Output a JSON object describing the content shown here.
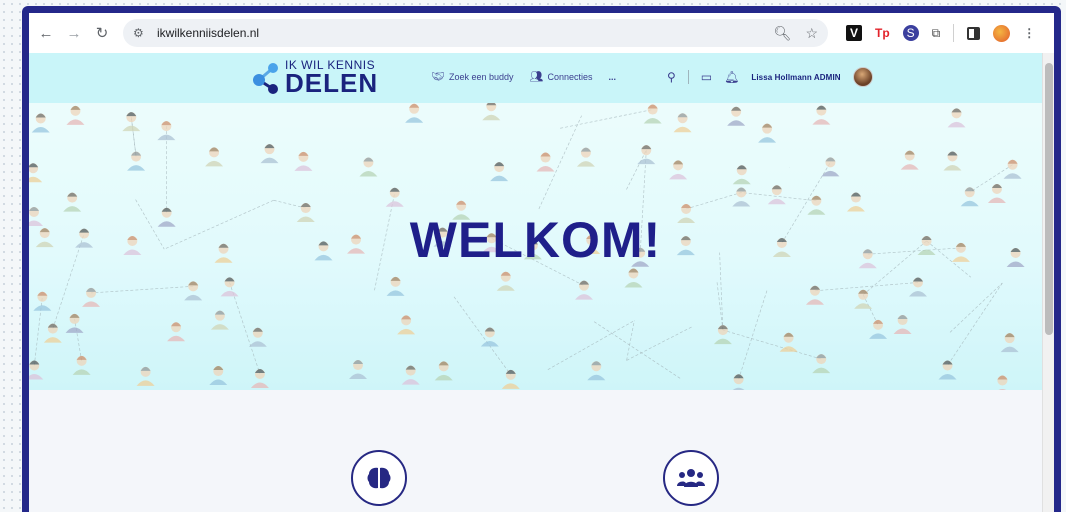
{
  "browser": {
    "url": "ikwilkenniisdelen.nl",
    "nav_icons": [
      "back-arrow-icon",
      "forward-arrow-icon",
      "reload-icon"
    ],
    "extensions": {
      "v": "V",
      "tp": "Tp",
      "s": "S"
    }
  },
  "site": {
    "logo_line1": "IK WIL KENNIS",
    "logo_line2": "DELEN",
    "nav": [
      {
        "label": "Zoek een buddy"
      },
      {
        "label": "Connecties"
      },
      {
        "label": "..."
      }
    ],
    "user_name": "Lissa Hollmann ADMIN"
  },
  "hero": {
    "title": "WELKOM!"
  },
  "features": [
    {
      "icon": "brain-icon"
    },
    {
      "icon": "users-icon"
    }
  ],
  "colors": {
    "brand": "#1f1f8a",
    "header_bg": "#c9f5f9",
    "frame": "#24288a"
  }
}
